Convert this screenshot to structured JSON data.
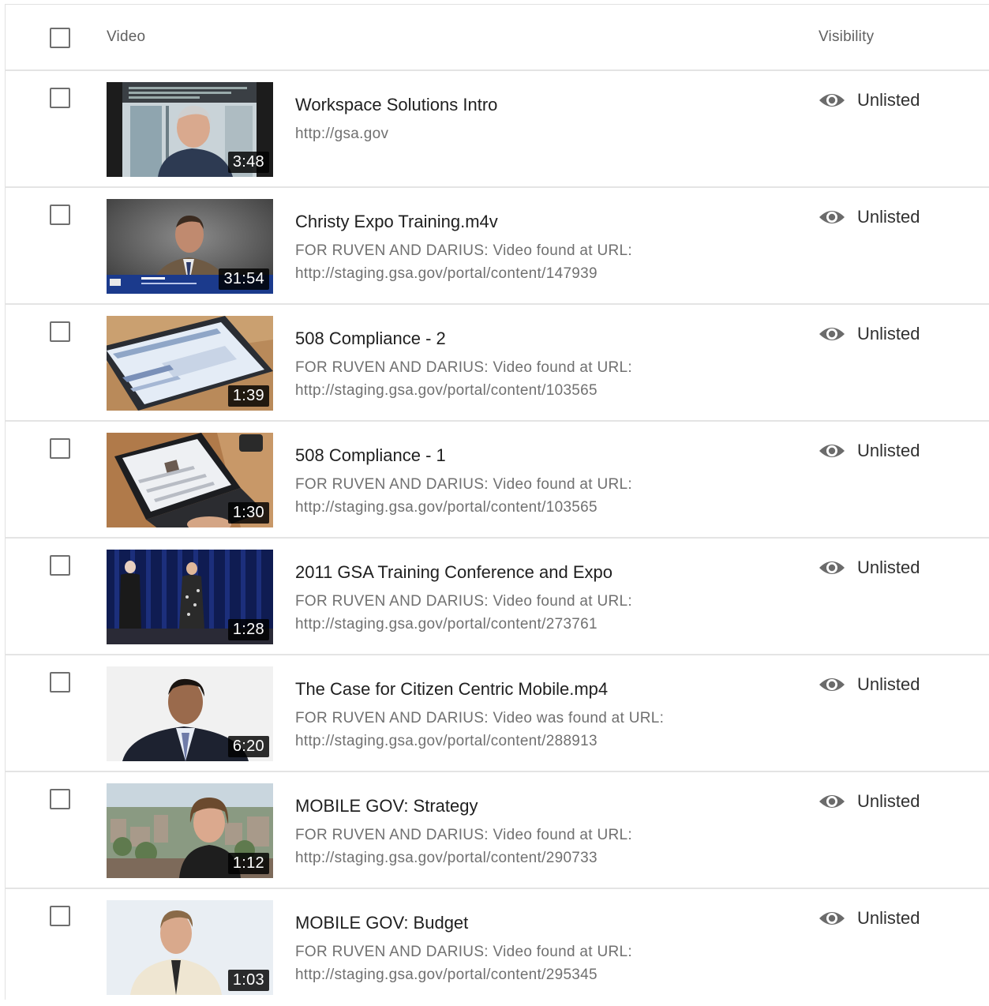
{
  "header": {
    "video_label": "Video",
    "visibility_label": "Visibility"
  },
  "rows": [
    {
      "title": "Workspace Solutions Intro",
      "description": "http://gsa.gov",
      "duration": "3:48",
      "visibility": "Unlisted",
      "thumbnail": "man-speaking-office-icon"
    },
    {
      "title": "Christy Expo Training.m4v",
      "description": "FOR RUVEN AND DARIUS: Video found at URL:\nhttp://staging.gsa.gov/portal/content/147939",
      "duration": "31:54",
      "visibility": "Unlisted",
      "thumbnail": "man-interview-icon"
    },
    {
      "title": "508 Compliance - 2",
      "description": "FOR RUVEN AND DARIUS: Video found at URL:\nhttp://staging.gsa.gov/portal/content/103565",
      "duration": "1:39",
      "visibility": "Unlisted",
      "thumbnail": "laptop-screen-icon"
    },
    {
      "title": "508 Compliance - 1",
      "description": "FOR RUVEN AND DARIUS: Video found at URL:\nhttp://staging.gsa.gov/portal/content/103565",
      "duration": "1:30",
      "visibility": "Unlisted",
      "thumbnail": "laptop-desk-icon"
    },
    {
      "title": "2011 GSA Training Conference and Expo",
      "description": "FOR RUVEN AND DARIUS: Video found at URL:\nhttp://staging.gsa.gov/portal/content/273761",
      "duration": "1:28",
      "visibility": "Unlisted",
      "thumbnail": "stage-presenters-icon"
    },
    {
      "title": "The Case for Citizen Centric Mobile.mp4",
      "description": "FOR RUVEN AND DARIUS: Video was found at URL:\nhttp://staging.gsa.gov/portal/content/288913",
      "duration": "6:20",
      "visibility": "Unlisted",
      "thumbnail": "man-suit-icon"
    },
    {
      "title": "MOBILE GOV: Strategy",
      "description": "FOR RUVEN AND DARIUS: Video found at URL:\nhttp://staging.gsa.gov/portal/content/290733",
      "duration": "1:12",
      "visibility": "Unlisted",
      "thumbnail": "woman-cityscape-icon"
    },
    {
      "title": "MOBILE GOV: Budget",
      "description": "FOR RUVEN AND DARIUS: Video found at URL:\nhttp://staging.gsa.gov/portal/content/295345",
      "duration": "1:03",
      "visibility": "Unlisted",
      "thumbnail": "man-shirt-tie-icon"
    }
  ]
}
